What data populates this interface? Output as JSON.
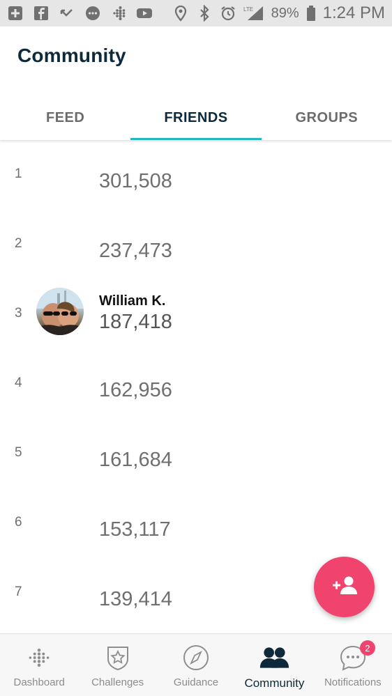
{
  "status_bar": {
    "battery": "89%",
    "network": "LTE",
    "time": "1:24 PM",
    "icons": [
      "plus-box-icon",
      "facebook-icon",
      "missed-call-icon",
      "chat-bubble-icon",
      "fitbit-icon",
      "youtube-icon",
      "location-icon",
      "bluetooth-icon",
      "alarm-icon",
      "signal-icon",
      "battery-icon"
    ]
  },
  "header": {
    "title": "Community",
    "tabs": [
      {
        "label": "FEED",
        "active": false
      },
      {
        "label": "FRIENDS",
        "active": true
      },
      {
        "label": "GROUPS",
        "active": false
      }
    ]
  },
  "leaderboard": [
    {
      "rank": "1",
      "steps": "301,508"
    },
    {
      "rank": "2",
      "steps": "237,473"
    },
    {
      "rank": "3",
      "name": "William K.",
      "steps": "187,418"
    },
    {
      "rank": "4",
      "steps": "162,956"
    },
    {
      "rank": "5",
      "steps": "161,684"
    },
    {
      "rank": "6",
      "steps": "153,117"
    },
    {
      "rank": "7",
      "steps": "139,414"
    }
  ],
  "fab": {
    "icon": "add-friend-icon"
  },
  "bottom_nav": [
    {
      "label": "Dashboard",
      "icon": "fitbit-dots-icon",
      "active": false
    },
    {
      "label": "Challenges",
      "icon": "shield-star-icon",
      "active": false
    },
    {
      "label": "Guidance",
      "icon": "compass-icon",
      "active": false
    },
    {
      "label": "Community",
      "icon": "people-icon",
      "active": true
    },
    {
      "label": "Notifications",
      "icon": "chat-bubble-icon",
      "active": false,
      "badge": "2"
    }
  ],
  "colors": {
    "accent": "#27b7c1",
    "fab": "#f0446f",
    "title": "#0e2a3a",
    "status_bar": "#e6e6e6"
  }
}
